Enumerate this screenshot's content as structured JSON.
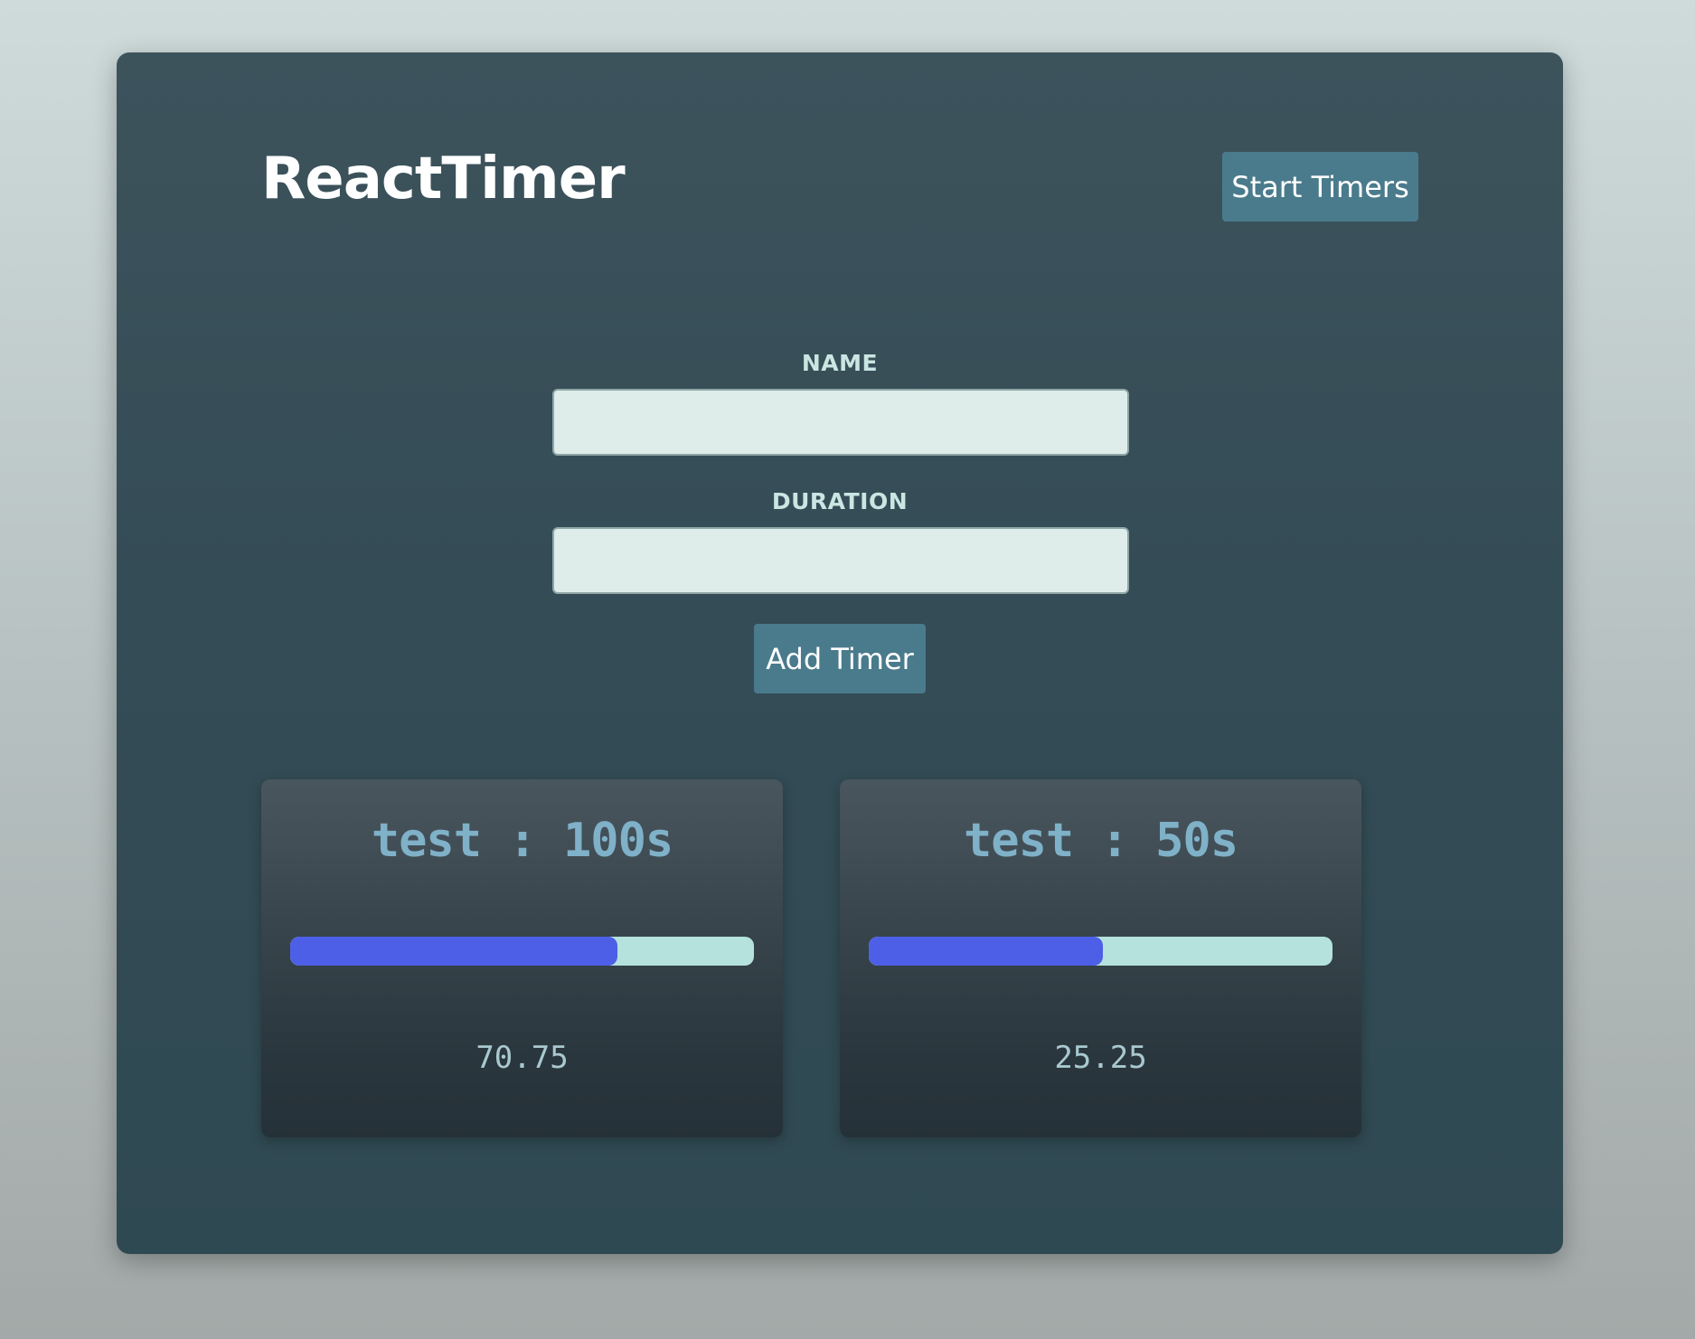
{
  "app": {
    "title": "ReactTimer",
    "start_button_label": "Start Timers"
  },
  "form": {
    "name_label": "NAME",
    "name_value": "",
    "duration_label": "DURATION",
    "duration_value": "",
    "add_button_label": "Add Timer"
  },
  "timers": [
    {
      "title": "test : 100s",
      "remaining": "70.75",
      "progress_fraction": 0.705
    },
    {
      "title": "test : 50s",
      "remaining": "25.25",
      "progress_fraction": 0.505
    }
  ],
  "colors": {
    "accent_button": "#4a7b8c",
    "progress_fill": "#4d5fe6",
    "progress_track": "#b5e2dd",
    "timer_text": "#7fb1c8"
  }
}
